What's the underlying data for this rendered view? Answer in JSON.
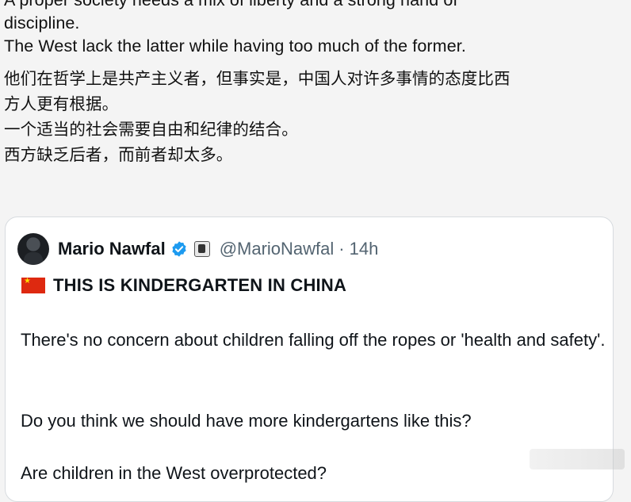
{
  "post": {
    "en_line1": "A proper society needs a mix of liberty and a strong hand of",
    "en_line2": "discipline.",
    "en_line3": "The West lack the latter while having too much of the former.",
    "cn_line1": "他们在哲学上是共产主义者，但事实是，中国人对许多事情的态度比西",
    "cn_line2": "方人更有根据。",
    "cn_line3": "一个适当的社会需要自由和纪律的结合。",
    "cn_line4": "西方缺乏后者，而前者却太多。"
  },
  "quote": {
    "name": "Mario Nawfal",
    "handle": "@MarioNawfal",
    "separator": "·",
    "time": "14h",
    "headline": "THIS IS KINDERGARTEN IN CHINA",
    "p1": "There's no concern about children falling off the ropes or 'health and safety'.",
    "p2": "Do you think we should have more kindergartens like this?",
    "p3": "Are children in the West overprotected?"
  },
  "colors": {
    "verified": "#1d9bf0",
    "secondary_text": "#536471",
    "flag_red": "#de2910",
    "flag_yellow": "#ffde00"
  },
  "icons": [
    "verified-badge-icon",
    "affiliate-badge-icon",
    "china-flag-icon"
  ]
}
